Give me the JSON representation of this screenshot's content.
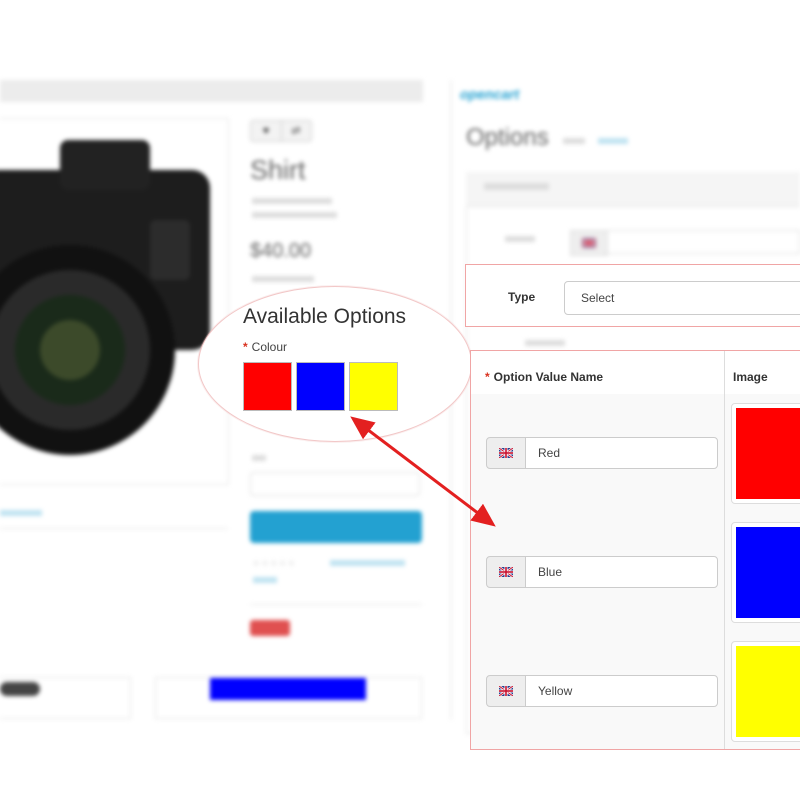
{
  "storefront": {
    "product_title": "Shirt",
    "price": "$40.00",
    "available_options_heading": "Available Options",
    "colour_label": "Colour",
    "required_marker": "*",
    "swatches": [
      {
        "name": "red",
        "color": "#ff0000"
      },
      {
        "name": "blue",
        "color": "#0000ff"
      },
      {
        "name": "yellow",
        "color": "#ffff00"
      }
    ]
  },
  "admin": {
    "logo": "opencart",
    "page_title": "Options",
    "type_label": "Type",
    "type_value": "Select",
    "table": {
      "required_marker": "*",
      "col_name_header": "Option Value Name",
      "col_image_header": "Image",
      "rows": [
        {
          "name": "Red",
          "color": "#ff0000"
        },
        {
          "name": "Blue",
          "color": "#0000ff"
        },
        {
          "name": "Yellow",
          "color": "#ffff00"
        }
      ]
    }
  },
  "annotation": {
    "arrow_color": "#e32020",
    "icon": "double-headed-arrow-icon"
  },
  "icons": {
    "language_flag": "uk-flag-icon"
  }
}
